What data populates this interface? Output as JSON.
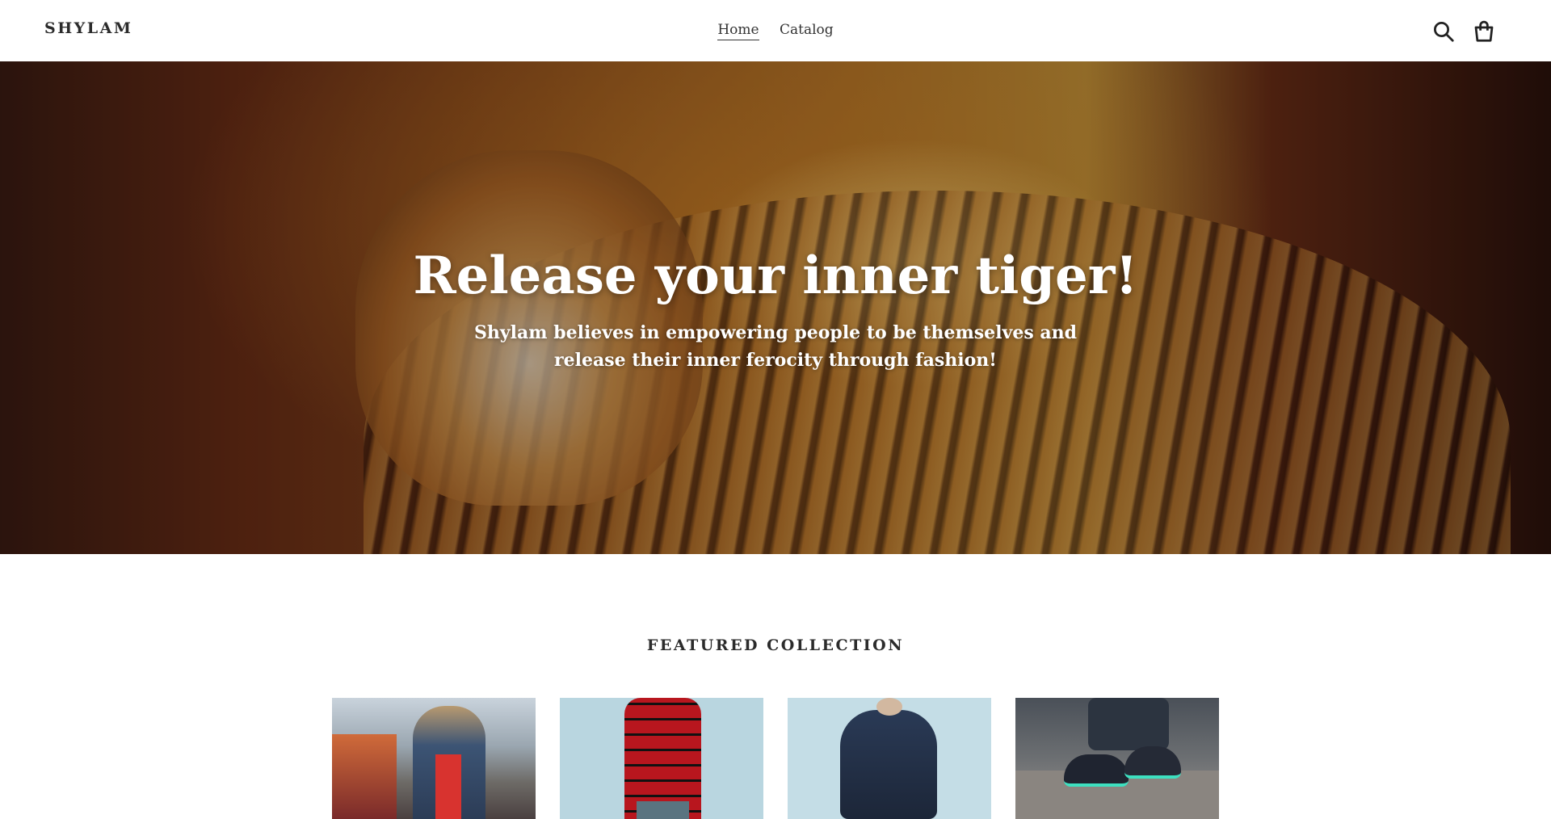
{
  "header": {
    "logo": "SHYLAM",
    "nav": [
      {
        "label": "Home",
        "active": true
      },
      {
        "label": "Catalog",
        "active": false
      }
    ],
    "icons": [
      "search-icon",
      "cart-icon"
    ]
  },
  "hero": {
    "title": "Release your inner tiger!",
    "subtitle": "Shylam believes in empowering people to be themselves and release their inner ferocity through fashion!"
  },
  "featured": {
    "title": "FEATURED COLLECTION"
  },
  "colors": {
    "text": "#2b2b2b",
    "background": "#ffffff",
    "hero_text": "#ffffff"
  }
}
